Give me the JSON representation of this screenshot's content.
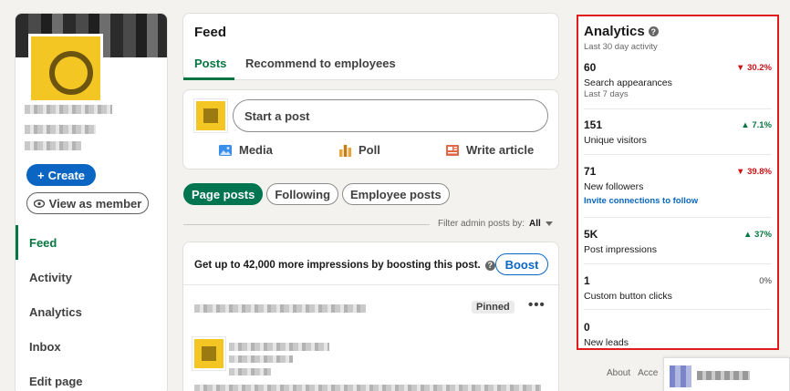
{
  "sidebar": {
    "create_label": "Create",
    "view_member_label": "View as member",
    "nav": [
      {
        "label": "Feed"
      },
      {
        "label": "Activity"
      },
      {
        "label": "Analytics"
      },
      {
        "label": "Inbox"
      },
      {
        "label": "Edit page"
      }
    ]
  },
  "feed": {
    "title": "Feed",
    "tabs": [
      "Posts",
      "Recommend to employees"
    ]
  },
  "composer": {
    "placeholder": "Start a post",
    "actions": [
      "Media",
      "Poll",
      "Write article"
    ]
  },
  "filters": {
    "chips": [
      "Page posts",
      "Following",
      "Employee posts"
    ],
    "admin_label": "Filter admin posts by:",
    "admin_value": "All"
  },
  "boost": {
    "text": "Get up to 42,000 more impressions by boosting this post.",
    "button": "Boost",
    "pinned": "Pinned"
  },
  "analytics": {
    "title": "Analytics",
    "subtitle": "Last 30 day activity",
    "metrics": [
      {
        "value": "60",
        "label": "Search appearances",
        "sublabel": "Last 7 days",
        "change": "30.2%",
        "direction": "down"
      },
      {
        "value": "151",
        "label": "Unique visitors",
        "change": "7.1%",
        "direction": "up"
      },
      {
        "value": "71",
        "label": "New followers",
        "link": "Invite connections to follow",
        "change": "39.8%",
        "direction": "down"
      },
      {
        "value": "5K",
        "label": "Post impressions",
        "change": "37%",
        "direction": "up"
      },
      {
        "value": "1",
        "label": "Custom button clicks",
        "change": "0%",
        "direction": "flat"
      },
      {
        "value": "0",
        "label": "New leads"
      }
    ]
  },
  "footer": {
    "links": [
      "About",
      "Acce"
    ]
  },
  "colors": {
    "accent_green": "#057642",
    "brand_blue": "#0a66c2",
    "down_red": "#cc1016",
    "highlight_border": "#e01c1c"
  }
}
